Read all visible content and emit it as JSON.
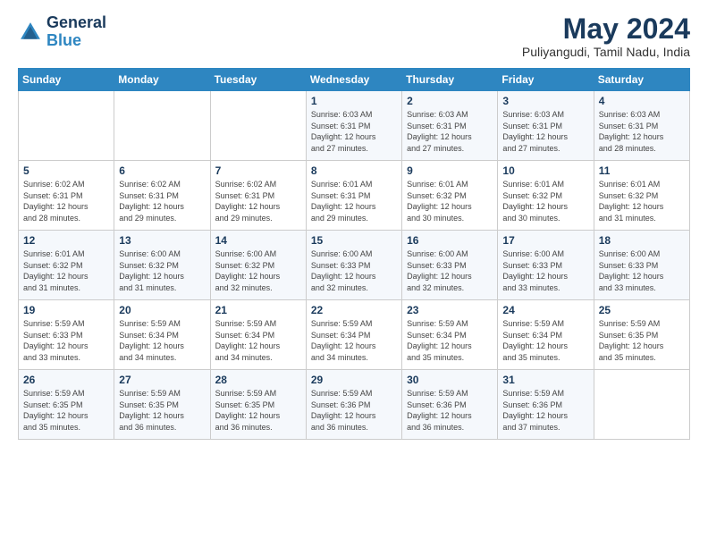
{
  "logo": {
    "line1": "General",
    "line2": "Blue"
  },
  "header": {
    "month": "May 2024",
    "location": "Puliyangudi, Tamil Nadu, India"
  },
  "days_of_week": [
    "Sunday",
    "Monday",
    "Tuesday",
    "Wednesday",
    "Thursday",
    "Friday",
    "Saturday"
  ],
  "weeks": [
    [
      {
        "day": "",
        "info": ""
      },
      {
        "day": "",
        "info": ""
      },
      {
        "day": "",
        "info": ""
      },
      {
        "day": "1",
        "info": "Sunrise: 6:03 AM\nSunset: 6:31 PM\nDaylight: 12 hours\nand 27 minutes."
      },
      {
        "day": "2",
        "info": "Sunrise: 6:03 AM\nSunset: 6:31 PM\nDaylight: 12 hours\nand 27 minutes."
      },
      {
        "day": "3",
        "info": "Sunrise: 6:03 AM\nSunset: 6:31 PM\nDaylight: 12 hours\nand 27 minutes."
      },
      {
        "day": "4",
        "info": "Sunrise: 6:03 AM\nSunset: 6:31 PM\nDaylight: 12 hours\nand 28 minutes."
      }
    ],
    [
      {
        "day": "5",
        "info": "Sunrise: 6:02 AM\nSunset: 6:31 PM\nDaylight: 12 hours\nand 28 minutes."
      },
      {
        "day": "6",
        "info": "Sunrise: 6:02 AM\nSunset: 6:31 PM\nDaylight: 12 hours\nand 29 minutes."
      },
      {
        "day": "7",
        "info": "Sunrise: 6:02 AM\nSunset: 6:31 PM\nDaylight: 12 hours\nand 29 minutes."
      },
      {
        "day": "8",
        "info": "Sunrise: 6:01 AM\nSunset: 6:31 PM\nDaylight: 12 hours\nand 29 minutes."
      },
      {
        "day": "9",
        "info": "Sunrise: 6:01 AM\nSunset: 6:32 PM\nDaylight: 12 hours\nand 30 minutes."
      },
      {
        "day": "10",
        "info": "Sunrise: 6:01 AM\nSunset: 6:32 PM\nDaylight: 12 hours\nand 30 minutes."
      },
      {
        "day": "11",
        "info": "Sunrise: 6:01 AM\nSunset: 6:32 PM\nDaylight: 12 hours\nand 31 minutes."
      }
    ],
    [
      {
        "day": "12",
        "info": "Sunrise: 6:01 AM\nSunset: 6:32 PM\nDaylight: 12 hours\nand 31 minutes."
      },
      {
        "day": "13",
        "info": "Sunrise: 6:00 AM\nSunset: 6:32 PM\nDaylight: 12 hours\nand 31 minutes."
      },
      {
        "day": "14",
        "info": "Sunrise: 6:00 AM\nSunset: 6:32 PM\nDaylight: 12 hours\nand 32 minutes."
      },
      {
        "day": "15",
        "info": "Sunrise: 6:00 AM\nSunset: 6:33 PM\nDaylight: 12 hours\nand 32 minutes."
      },
      {
        "day": "16",
        "info": "Sunrise: 6:00 AM\nSunset: 6:33 PM\nDaylight: 12 hours\nand 32 minutes."
      },
      {
        "day": "17",
        "info": "Sunrise: 6:00 AM\nSunset: 6:33 PM\nDaylight: 12 hours\nand 33 minutes."
      },
      {
        "day": "18",
        "info": "Sunrise: 6:00 AM\nSunset: 6:33 PM\nDaylight: 12 hours\nand 33 minutes."
      }
    ],
    [
      {
        "day": "19",
        "info": "Sunrise: 5:59 AM\nSunset: 6:33 PM\nDaylight: 12 hours\nand 33 minutes."
      },
      {
        "day": "20",
        "info": "Sunrise: 5:59 AM\nSunset: 6:34 PM\nDaylight: 12 hours\nand 34 minutes."
      },
      {
        "day": "21",
        "info": "Sunrise: 5:59 AM\nSunset: 6:34 PM\nDaylight: 12 hours\nand 34 minutes."
      },
      {
        "day": "22",
        "info": "Sunrise: 5:59 AM\nSunset: 6:34 PM\nDaylight: 12 hours\nand 34 minutes."
      },
      {
        "day": "23",
        "info": "Sunrise: 5:59 AM\nSunset: 6:34 PM\nDaylight: 12 hours\nand 35 minutes."
      },
      {
        "day": "24",
        "info": "Sunrise: 5:59 AM\nSunset: 6:34 PM\nDaylight: 12 hours\nand 35 minutes."
      },
      {
        "day": "25",
        "info": "Sunrise: 5:59 AM\nSunset: 6:35 PM\nDaylight: 12 hours\nand 35 minutes."
      }
    ],
    [
      {
        "day": "26",
        "info": "Sunrise: 5:59 AM\nSunset: 6:35 PM\nDaylight: 12 hours\nand 35 minutes."
      },
      {
        "day": "27",
        "info": "Sunrise: 5:59 AM\nSunset: 6:35 PM\nDaylight: 12 hours\nand 36 minutes."
      },
      {
        "day": "28",
        "info": "Sunrise: 5:59 AM\nSunset: 6:35 PM\nDaylight: 12 hours\nand 36 minutes."
      },
      {
        "day": "29",
        "info": "Sunrise: 5:59 AM\nSunset: 6:36 PM\nDaylight: 12 hours\nand 36 minutes."
      },
      {
        "day": "30",
        "info": "Sunrise: 5:59 AM\nSunset: 6:36 PM\nDaylight: 12 hours\nand 36 minutes."
      },
      {
        "day": "31",
        "info": "Sunrise: 5:59 AM\nSunset: 6:36 PM\nDaylight: 12 hours\nand 37 minutes."
      },
      {
        "day": "",
        "info": ""
      }
    ]
  ]
}
